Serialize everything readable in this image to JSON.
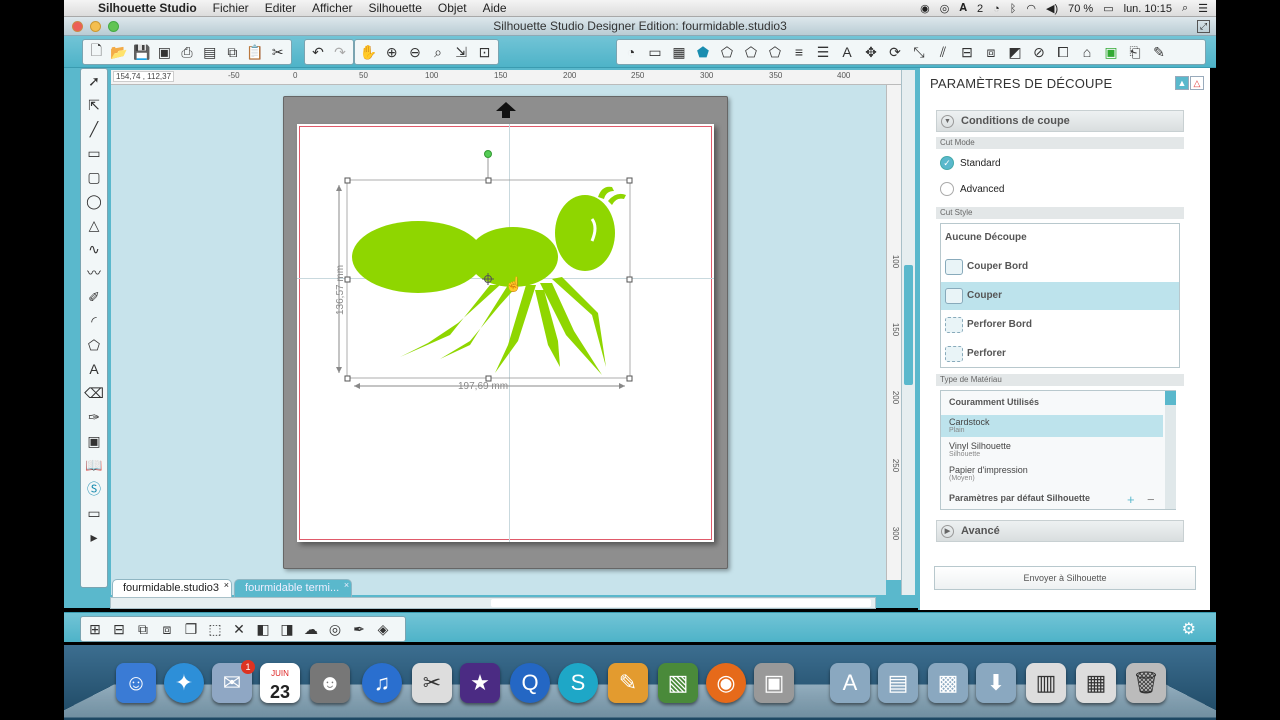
{
  "menubar": {
    "app_name": "Silhouette Studio",
    "items": [
      "Fichier",
      "Editer",
      "Afficher",
      "Silhouette",
      "Objet",
      "Aide"
    ],
    "status": {
      "battery": "70 %",
      "clock": "lun. 10:15",
      "adobe_count": "2"
    }
  },
  "window": {
    "title": "Silhouette Studio Designer Edition: fourmidable.studio3"
  },
  "canvas": {
    "coords": "154,74 , 112,37",
    "ruler_top_labels": [
      "-50",
      "0",
      "50",
      "100",
      "150",
      "200",
      "250",
      "300",
      "350",
      "400"
    ],
    "ruler_left_labels": [
      "100",
      "150",
      "200",
      "250",
      "300"
    ],
    "width_dim": "197,69 mm",
    "height_dim": "136,57 mm",
    "shape_color": "#8fd600"
  },
  "tabs": [
    {
      "label": "fourmidable.studio3",
      "active": true
    },
    {
      "label": "fourmidable termi...",
      "active": false
    }
  ],
  "panel": {
    "title": "PARAMÈTRES DE DÉCOUPE",
    "conditions": "Conditions de coupe",
    "cut_mode_label": "Cut Mode",
    "modes": [
      {
        "label": "Standard",
        "selected": true
      },
      {
        "label": "Advanced",
        "selected": false
      }
    ],
    "cut_style_label": "Cut Style",
    "styles": [
      {
        "label": "Aucune Découpe",
        "selected": false
      },
      {
        "label": "Couper Bord",
        "selected": false
      },
      {
        "label": "Couper",
        "selected": true
      },
      {
        "label": "Perforer Bord",
        "selected": false
      },
      {
        "label": "Perforer",
        "selected": false
      }
    ],
    "material_type_label": "Type de Matériau",
    "materials_header": "Couramment Utilisés",
    "materials": [
      {
        "name": "Cardstock",
        "sub": "Plain",
        "selected": true
      },
      {
        "name": "Vinyl Silhouette",
        "sub": "Silhouette",
        "selected": false
      },
      {
        "name": "Papier d'impression",
        "sub": "(Moyen)",
        "selected": false
      }
    ],
    "materials_footer": "Paramètres par défaut Silhouette",
    "advanced": "Avancé",
    "send_button": "Envoyer à Silhouette"
  },
  "dock": {
    "calendar_month": "JUIN",
    "calendar_day": "23",
    "mail_badge": "1"
  }
}
